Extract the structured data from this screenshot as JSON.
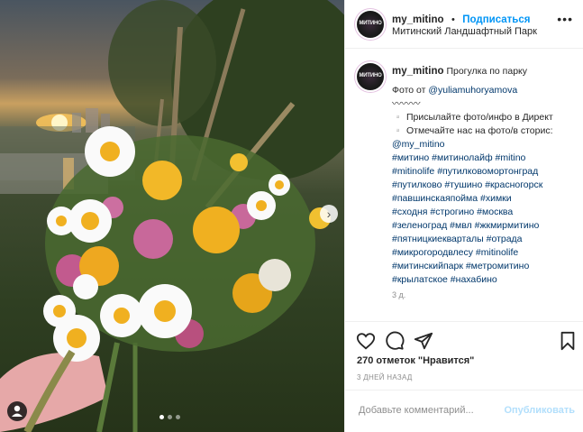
{
  "header": {
    "username": "my_mitino",
    "separator": "•",
    "follow_label": "Подписаться",
    "location": "Митинский Ландшафтный Парк",
    "avatar_text": "МИТИНО",
    "more_icon": "ellipsis-icon"
  },
  "caption": {
    "username": "my_mitino",
    "title": "Прогулка по парку",
    "photo_by_prefix": "Фото от ",
    "photo_by_user": "@yuliamuhoryamova",
    "waves": "〰〰〰",
    "line_send": "▫️ Присылайте фото/инфо в Директ",
    "line_tag": "▫️ Отмечайте нас на фото/в сторис:",
    "mention": "@my_mitino",
    "hashtag_lines": [
      "#митино #митинолайф #mitino",
      "#mitinolife #путилковомортонград",
      "#путилково #тушино #красногорск",
      "#павшинскаяпойма #химки",
      "#сходня #строгино #москва",
      "#зеленоград #мвл #жкмирмитино",
      "#пятницкиекварталы #отрада",
      "#микрогородвлесу #mitinolife",
      "#митинскийпарк #метромитино",
      "#крылатское #нахабино"
    ],
    "time": "3 д."
  },
  "actions": {
    "like_icon": "heart-icon",
    "comment_icon": "comment-icon",
    "share_icon": "paper-plane-icon",
    "save_icon": "bookmark-icon"
  },
  "likes_text": "270 отметок \"Нравится\"",
  "date_text": "3 ДНЕЙ НАЗАД",
  "comment": {
    "placeholder": "Добавьте комментарий...",
    "publish_label": "Опубликовать"
  },
  "carousel": {
    "total": 3,
    "active_index": 0
  }
}
